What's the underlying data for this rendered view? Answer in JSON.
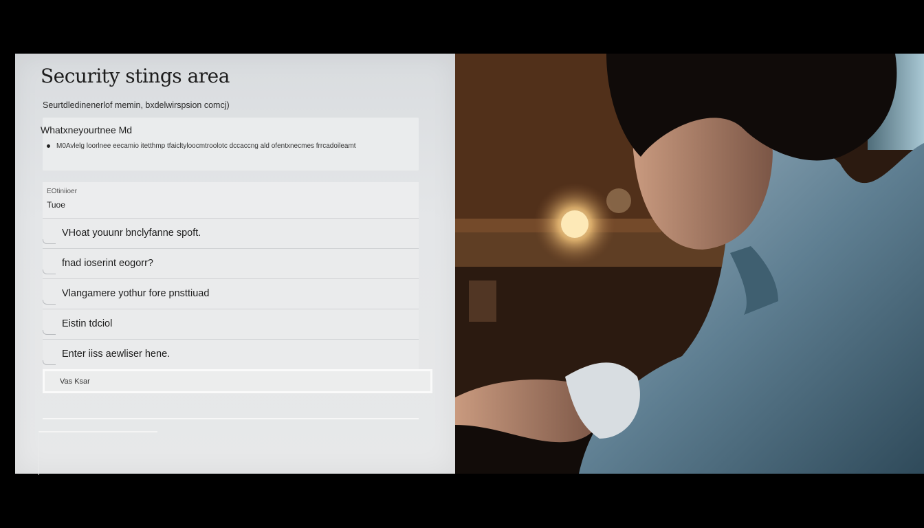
{
  "panel": {
    "title": "Security stings area",
    "subtitle": "Seurtdledinenerlof memin, bxdelwirspsion comcj)",
    "info": {
      "heading": "Whatxneyourtnee Md",
      "bullet": "M0Avlelg loorlnee eecamio itetthmp tfaicltyloocmtroolotc dccaccng ald ofentxnecmes frrcadoileamt"
    },
    "select": {
      "label": "EOtiniioer",
      "value": "Tuoe"
    },
    "questions": [
      {
        "text": "VHoat youunr bnclyfanne spoft."
      },
      {
        "text": "fnad ioserint eogorr?"
      },
      {
        "text": "Vlangamere yothur fore  pnsttiuad"
      },
      {
        "text": "Eistin tdciol"
      },
      {
        "text": "Enter iiss aewliser hene."
      }
    ],
    "answer_placeholder": "Vas Ksar"
  },
  "colors": {
    "panel_bg": "#e4e6e8",
    "page_bg": "#000000",
    "photo_warm": "#7a4d2c",
    "shirt_blue": "#4b6f84"
  }
}
